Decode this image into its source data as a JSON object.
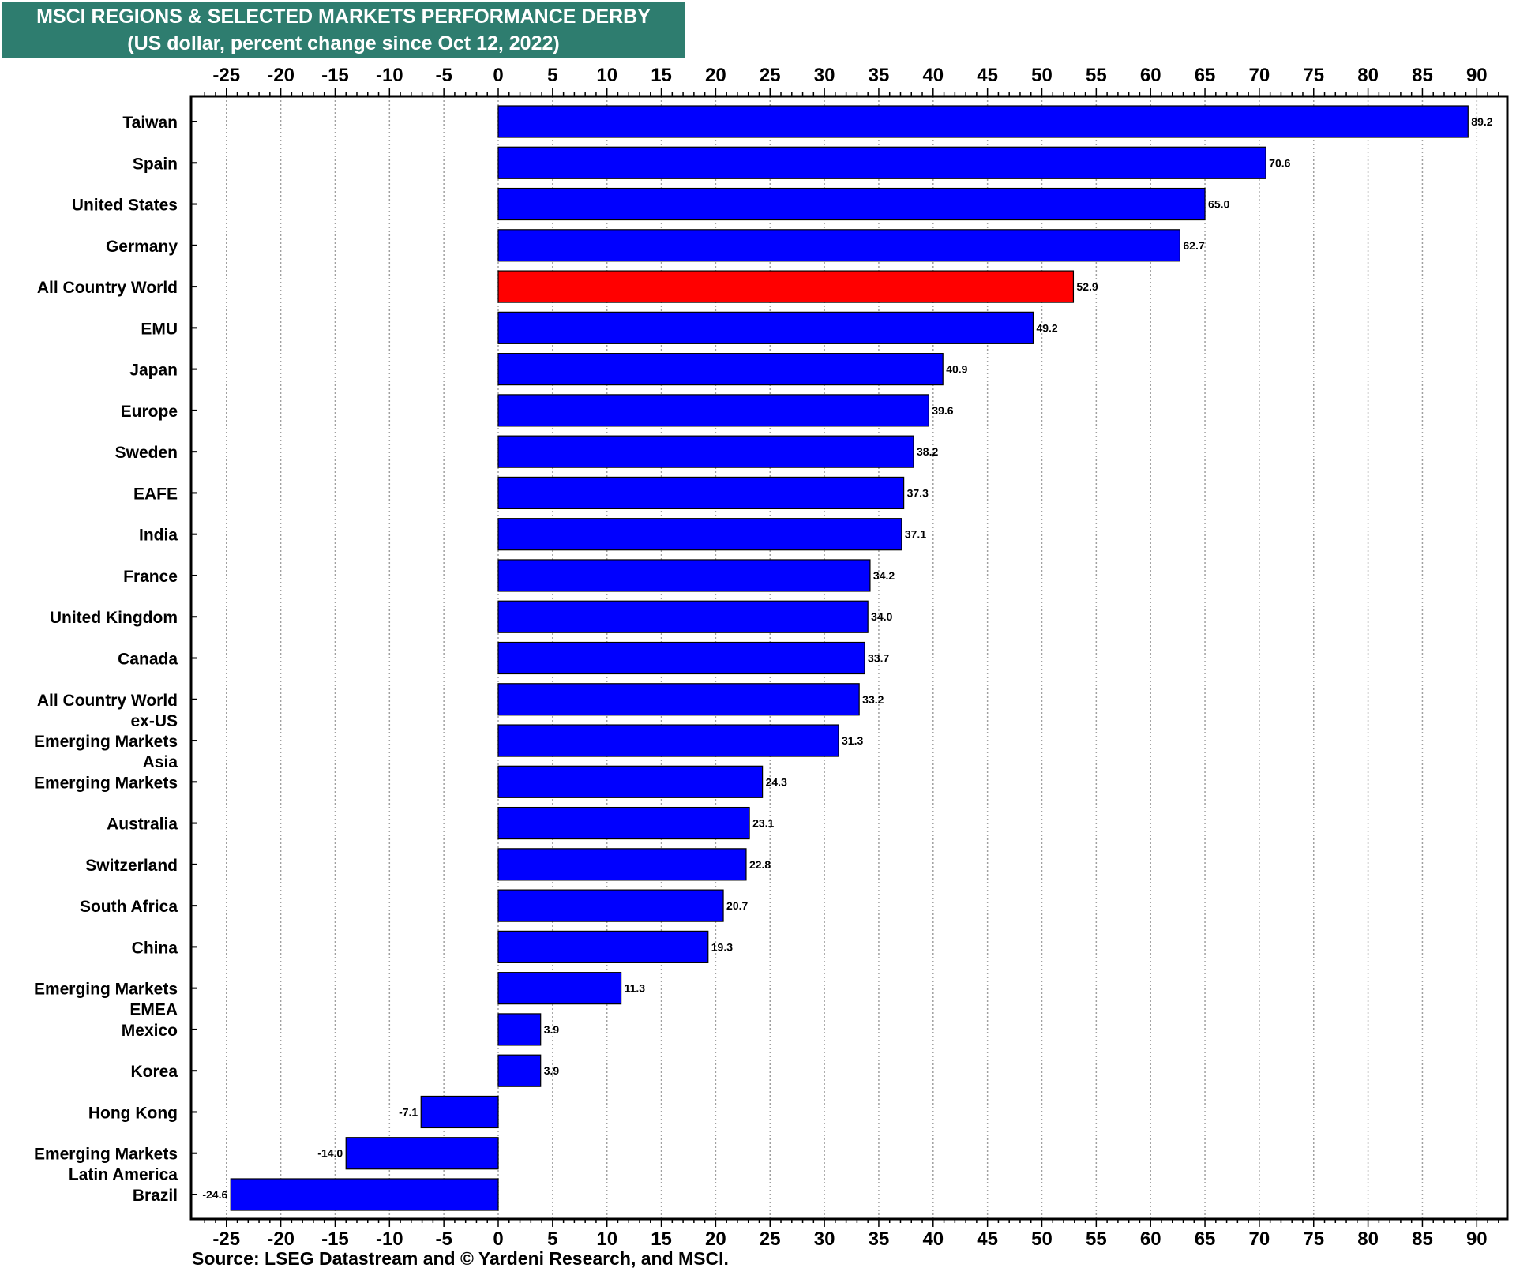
{
  "header": {
    "title": "MSCI REGIONS & SELECTED MARKETS PERFORMANCE DERBY",
    "subtitle": "(US dollar, percent change since Oct 12, 2022)"
  },
  "source": "Source: LSEG Datastream and © Yardeni Research, and MSCI.",
  "colors": {
    "banner": "#2e7d6f",
    "bar": "#0000ff",
    "highlight_bar": "#ff0000"
  },
  "chart_data": {
    "type": "bar",
    "orientation": "horizontal",
    "title": "MSCI REGIONS & SELECTED MARKETS PERFORMANCE DERBY",
    "subtitle": "(US dollar, percent change since Oct 12, 2022)",
    "xlabel": "",
    "ylabel": "",
    "xlim": [
      -27.5,
      93.5
    ],
    "xticks": [
      -25,
      -20,
      -15,
      -10,
      -5,
      0,
      5,
      10,
      15,
      20,
      25,
      30,
      35,
      40,
      45,
      50,
      55,
      60,
      65,
      70,
      75,
      80,
      85,
      90
    ],
    "minor_tick_step": 1,
    "grid": "vertical dotted at major ticks",
    "x_axis_labels": "top and bottom",
    "categories": [
      [
        "Taiwan"
      ],
      [
        "Spain"
      ],
      [
        "United States"
      ],
      [
        "Germany"
      ],
      [
        "All Country World"
      ],
      [
        "EMU"
      ],
      [
        "Japan"
      ],
      [
        "Europe"
      ],
      [
        "Sweden"
      ],
      [
        "EAFE"
      ],
      [
        "India"
      ],
      [
        "France"
      ],
      [
        "United Kingdom"
      ],
      [
        "Canada"
      ],
      [
        "All Country World",
        "ex-US"
      ],
      [
        "Emerging Markets",
        "Asia"
      ],
      [
        "Emerging Markets"
      ],
      [
        "Australia"
      ],
      [
        "Switzerland"
      ],
      [
        "South Africa"
      ],
      [
        "China"
      ],
      [
        "Emerging Markets",
        "EMEA"
      ],
      [
        "Mexico"
      ],
      [
        "Korea"
      ],
      [
        "Hong Kong"
      ],
      [
        "Emerging Markets",
        "Latin America"
      ],
      [
        "Brazil"
      ]
    ],
    "values": [
      89.2,
      70.6,
      65.0,
      62.7,
      52.9,
      49.2,
      40.9,
      39.6,
      38.2,
      37.3,
      37.1,
      34.2,
      34.0,
      33.7,
      33.2,
      31.3,
      24.3,
      23.1,
      22.8,
      20.7,
      19.3,
      11.3,
      3.9,
      3.9,
      -7.1,
      -14.0,
      -24.6
    ],
    "value_labels": [
      "89.2",
      "70.6",
      "65.0",
      "62.7",
      "52.9",
      "49.2",
      "40.9",
      "39.6",
      "38.2",
      "37.3",
      "37.1",
      "34.2",
      "34.0",
      "33.7",
      "33.2",
      "31.3",
      "24.3",
      "23.1",
      "22.8",
      "20.7",
      "19.3",
      "11.3",
      "3.9",
      "3.9",
      "-7.1",
      "-14.0",
      "-24.6"
    ],
    "highlight": [
      "All Country World"
    ],
    "legend": "none"
  }
}
